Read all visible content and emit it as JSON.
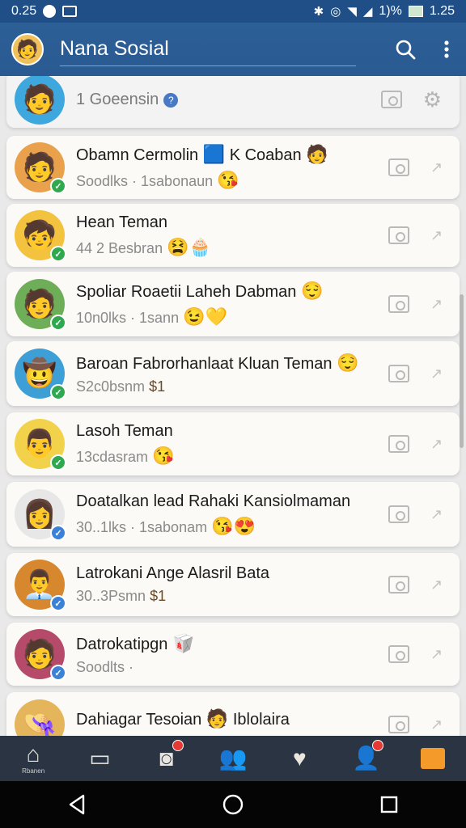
{
  "status_bar": {
    "time": "0.25",
    "battery": "1.25",
    "percent": "1)%"
  },
  "app_bar": {
    "title": "Nana Sosial"
  },
  "top_card": {
    "label": "1 Goeensin"
  },
  "chats": [
    {
      "name": "Obamn Cermolin",
      "name_extra": "K Coaban",
      "sub": "Soodlks · 1sabonaun",
      "avatar": "🧑",
      "avatar_bg": "#e9a14c",
      "badge": "green",
      "emoji_name_1": "🟦",
      "emoji_name_2": "🧑",
      "emoji_sub": "😘"
    },
    {
      "name": "Hean Teman",
      "name_extra": "",
      "sub": "44 2 Besbran",
      "avatar": "🧒",
      "avatar_bg": "#f3c23f",
      "badge": "green",
      "emoji_name_1": "",
      "emoji_name_2": "",
      "emoji_sub": "😫🧁"
    },
    {
      "name": "Spoliar Roaetii Laheh Dabman",
      "name_extra": "",
      "sub": "10n0lks · 1sann",
      "avatar": "🧑",
      "avatar_bg": "#6fae58",
      "badge": "green",
      "emoji_name_1": "😌",
      "emoji_name_2": "",
      "emoji_sub": "😉💛"
    },
    {
      "name": "Baroan Fabrorhanlaat Kluan Teman",
      "name_extra": "",
      "sub": "S2c0bsnm",
      "sub_extra": "$1",
      "avatar": "🤠",
      "avatar_bg": "#3d9fd6",
      "badge": "green",
      "emoji_name_1": "😌",
      "emoji_name_2": "",
      "emoji_sub": ""
    },
    {
      "name": "Lasoh Teman",
      "name_extra": "",
      "sub": "13cdasram",
      "avatar": "👨",
      "avatar_bg": "#f2d24a",
      "badge": "green",
      "emoji_name_1": "",
      "emoji_name_2": "",
      "emoji_sub": "😘"
    },
    {
      "name": "Doatalkan lead Rahaki Kansiolmaman",
      "name_extra": "",
      "sub": "30..1lks · 1sabonam",
      "avatar": "👩",
      "avatar_bg": "#e7e7e7",
      "badge": "blue",
      "emoji_name_1": "",
      "emoji_name_2": "",
      "emoji_sub": "😘😍"
    },
    {
      "name": "Latrokani Ange Alasril Bata",
      "name_extra": "",
      "sub": "30..3Psmn",
      "sub_extra": "$1",
      "avatar": "👨‍💼",
      "avatar_bg": "#d7872e",
      "badge": "blue",
      "emoji_name_1": "",
      "emoji_name_2": "",
      "emoji_sub": ""
    },
    {
      "name": "Datrokatipgn",
      "name_extra": "",
      "sub": "Soodlts ·",
      "avatar": "🧑",
      "avatar_bg": "#b64a6a",
      "badge": "blue",
      "emoji_name_1": "🥡",
      "emoji_name_2": "",
      "emoji_sub": ""
    },
    {
      "name": "Dahiagar Tesoian",
      "name_extra": "Iblolaira",
      "sub": "",
      "avatar": "👒",
      "avatar_bg": "#e4b55a",
      "badge": "",
      "emoji_name_1": "🧑",
      "emoji_name_2": "",
      "emoji_sub": ""
    }
  ],
  "bottom_nav": {
    "home_label": "Rbanen"
  },
  "icons": {
    "search": "search-icon",
    "more": "more-vert-icon",
    "camera": "camera-icon",
    "share": "share-icon",
    "gear": "gear-icon"
  },
  "colors": {
    "app_bar": "#2d5f97",
    "badge_green": "#2fa84f",
    "badge_blue": "#3b82d6",
    "bottom_nav": "#2a3443"
  }
}
